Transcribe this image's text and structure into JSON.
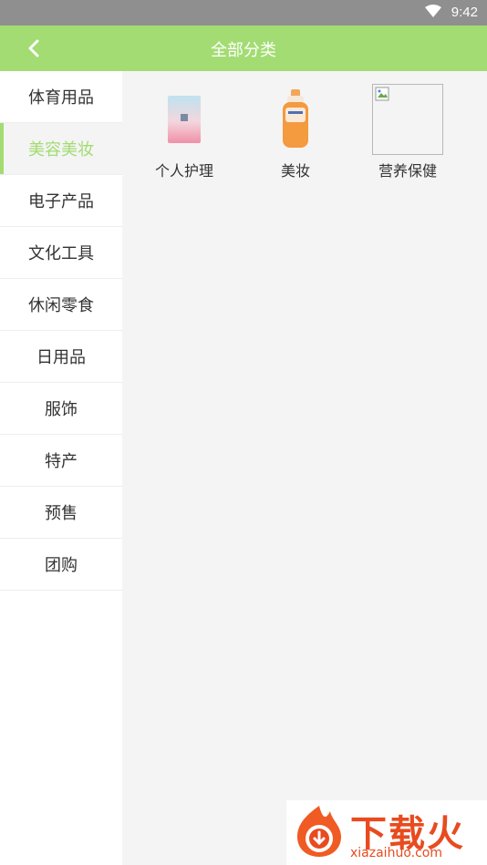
{
  "status": {
    "time": "9:42"
  },
  "header": {
    "title": "全部分类"
  },
  "sidebar": {
    "items": [
      {
        "label": "体育用品"
      },
      {
        "label": "美容美妆",
        "active": true
      },
      {
        "label": "电子产品"
      },
      {
        "label": "文化工具"
      },
      {
        "label": "休闲零食"
      },
      {
        "label": "日用品"
      },
      {
        "label": "服饰"
      },
      {
        "label": "特产"
      },
      {
        "label": "预售"
      },
      {
        "label": "团购"
      }
    ]
  },
  "categories": [
    {
      "label": "个人护理",
      "icon": "skincare-bag-image"
    },
    {
      "label": "美妆",
      "icon": "lotion-bottle-image"
    },
    {
      "label": "营养保健",
      "icon": "broken-image"
    }
  ],
  "watermark": {
    "brand": "下载火",
    "site": "xiazaihuo.com"
  },
  "colors": {
    "accent": "#a2dc72",
    "statusbar": "#8f8f8f",
    "watermark": "#e84b1f"
  }
}
